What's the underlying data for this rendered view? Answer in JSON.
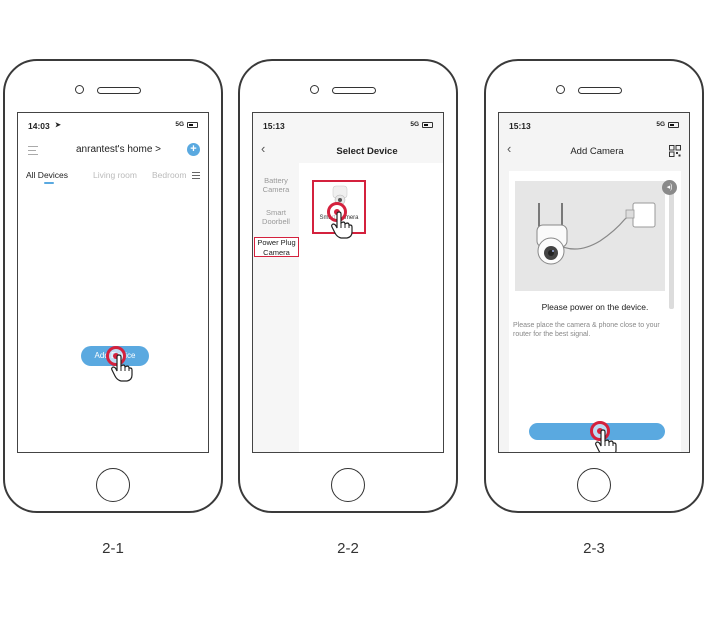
{
  "captions": [
    "2-1",
    "2-2",
    "2-3"
  ],
  "screen1": {
    "time": "14:03",
    "network": "5G",
    "home_title": "anrantest's home >",
    "tabs": [
      "All Devices",
      "Living room",
      "Bedroom"
    ],
    "add_device_label": "Add Device"
  },
  "screen2": {
    "time": "15:13",
    "network": "5G",
    "title": "Select Device",
    "categories": [
      "Battery\nCamera",
      "Smart\nDoorbell",
      "Power Plug\nCamera"
    ],
    "device_label": "Smart Camera"
  },
  "screen3": {
    "time": "15:13",
    "network": "5G",
    "title": "Add Camera",
    "instruction_title": "Please power on the device.",
    "instruction_body": "Please place the camera & phone close to your router for the best signal."
  },
  "colors": {
    "accent": "#5aa9e0",
    "highlight": "#d4213d",
    "screen_bg": "#f6f6f6"
  }
}
